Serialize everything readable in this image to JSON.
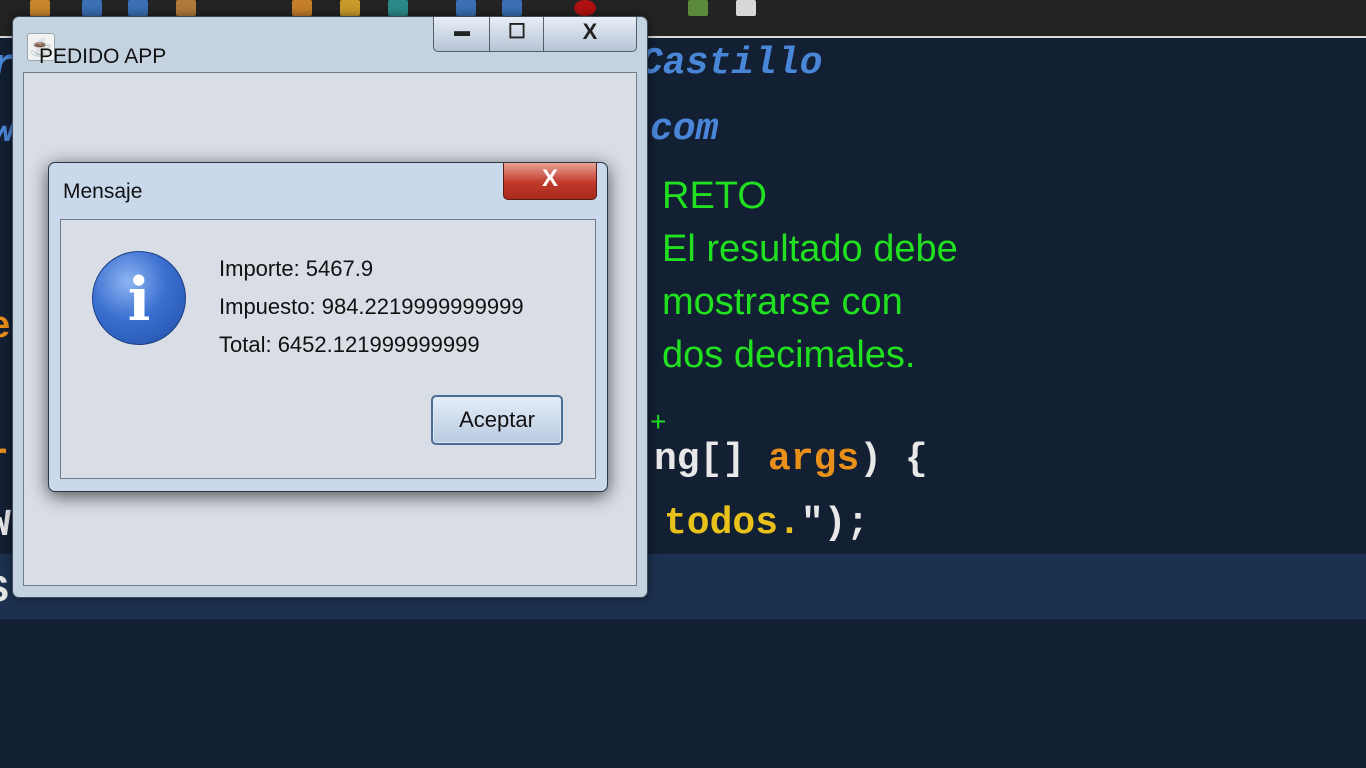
{
  "colors": {
    "editor_bg": "#131f33",
    "current_line": "#1c3150",
    "comment_blue": "#4a86d8",
    "note_green": "#20e020",
    "keyword_orange": "#e8901a",
    "string_yellow": "#e8c21a"
  },
  "editor": {
    "line1": "r",
    "line1_tail": "Castillo",
    "line2": "w",
    "line2_tail": "com",
    "note": {
      "l1": "RETO",
      "l2": "El resultado debe",
      "l3": "mostrarse con",
      "l4": "dos decimales.",
      "marker": "+"
    },
    "main_sig_a": "ng[] ",
    "main_sig_b": "args",
    "main_sig_c": ") {",
    "print_tail_a": "todos.",
    "print_tail_b": "\");",
    "left_chars": {
      "a": "e",
      "b": "r",
      "c": "W",
      "d": "S"
    }
  },
  "frame": {
    "title": "PEDIDO APP",
    "app_icon": "java-icon",
    "minimize_glyph": "▬",
    "maximize_glyph": "☐",
    "close_glyph": "X"
  },
  "dialog": {
    "title": "Mensaje",
    "close_glyph": "X",
    "icon": "information-icon",
    "icon_glyph": "i",
    "lines": [
      "Importe: 5467.9",
      "Impuesto: 984.2219999999999",
      "Total: 6452.121999999999"
    ],
    "ok_label": "Aceptar"
  }
}
